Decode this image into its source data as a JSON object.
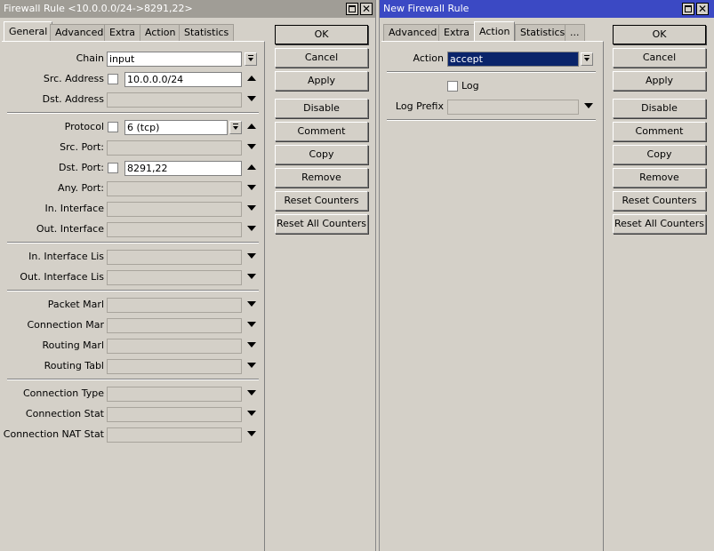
{
  "window1": {
    "title": "Firewall Rule <10.0.0.0/24->8291,22>",
    "tabs": [
      "General",
      "Advanced",
      "Extra",
      "Action",
      "Statistics"
    ],
    "active_tab": "General",
    "fields": {
      "chain": {
        "label": "Chain",
        "value": "input"
      },
      "src_address": {
        "label": "Src. Address",
        "value": "10.0.0.0/24"
      },
      "dst_address": {
        "label": "Dst. Address",
        "value": ""
      },
      "protocol": {
        "label": "Protocol",
        "value": "6 (tcp)"
      },
      "src_port": {
        "label": "Src. Port:",
        "value": ""
      },
      "dst_port": {
        "label": "Dst. Port:",
        "value": "8291,22"
      },
      "any_port": {
        "label": "Any. Port:",
        "value": ""
      },
      "in_interface": {
        "label": "In. Interface",
        "value": ""
      },
      "out_interface": {
        "label": "Out. Interface",
        "value": ""
      },
      "in_interface_list": {
        "label": "In. Interface Lis",
        "value": ""
      },
      "out_interface_list": {
        "label": "Out. Interface Lis",
        "value": ""
      },
      "packet_mark": {
        "label": "Packet Marl",
        "value": ""
      },
      "connection_mark": {
        "label": "Connection Mar",
        "value": ""
      },
      "routing_mark": {
        "label": "Routing Marl",
        "value": ""
      },
      "routing_table": {
        "label": "Routing Tabl",
        "value": ""
      },
      "connection_type": {
        "label": "Connection Type",
        "value": ""
      },
      "connection_state": {
        "label": "Connection Stat",
        "value": ""
      },
      "connection_nat_state": {
        "label": "Connection NAT Stat",
        "value": ""
      }
    },
    "buttons": [
      "OK",
      "Cancel",
      "Apply",
      "Disable",
      "Comment",
      "Copy",
      "Remove",
      "Reset Counters",
      "Reset All Counters"
    ]
  },
  "window2": {
    "title": "New Firewall Rule",
    "tabs": [
      "Advanced",
      "Extra",
      "Action",
      "Statistics",
      "..."
    ],
    "active_tab": "Action",
    "action": {
      "label": "Action",
      "value": "accept"
    },
    "log": {
      "label": "Log",
      "checked": false
    },
    "log_prefix": {
      "label": "Log Prefix",
      "value": ""
    },
    "buttons": [
      "OK",
      "Cancel",
      "Apply",
      "Disable",
      "Comment",
      "Copy",
      "Remove",
      "Reset Counters",
      "Reset All Counters"
    ]
  },
  "colors": {
    "active_titlebar": "#3b49c4",
    "inactive_titlebar": "#a09d96",
    "window_bg": "#d4d0c8",
    "selection": "#0a246a"
  }
}
